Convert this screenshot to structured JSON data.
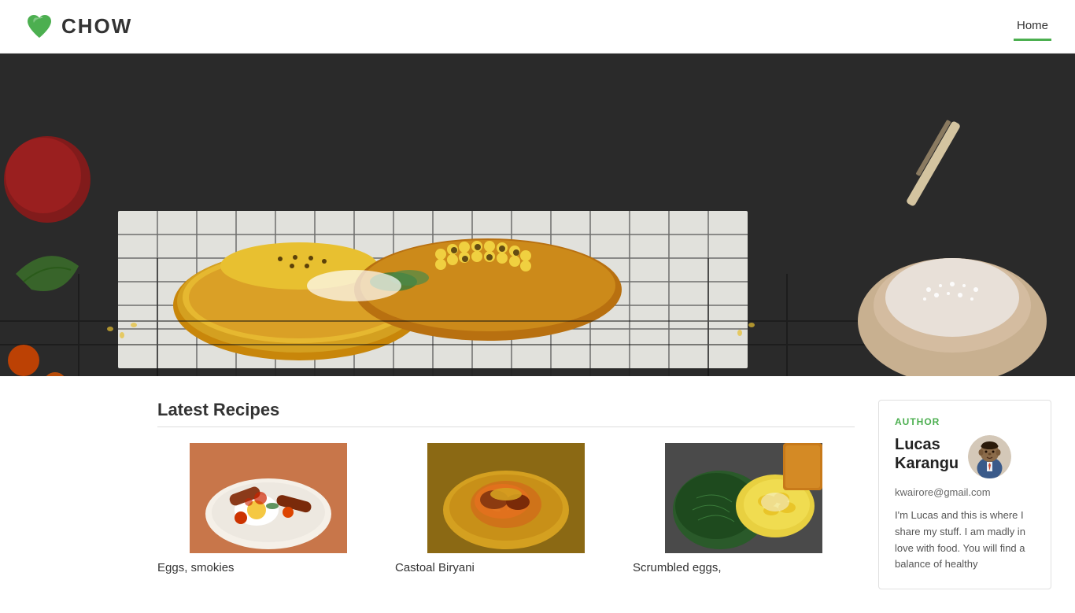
{
  "navbar": {
    "logo_text": "CHOW",
    "links": [
      {
        "label": "Home",
        "active": true
      }
    ]
  },
  "hero": {
    "alt": "Grilled corn on toast hero image"
  },
  "recipes_section": {
    "title": "Latest Recipes",
    "cards": [
      {
        "id": 1,
        "title": "Eggs, smokies",
        "image_color1": "#c8764a",
        "image_color2": "#8b3a1a",
        "image_label": "eggs-smokies"
      },
      {
        "id": 2,
        "title": "Castoal Biryani",
        "image_color1": "#d4a017",
        "image_color2": "#8b6914",
        "image_label": "biryani"
      },
      {
        "id": 3,
        "title": "Scrumbled eggs,",
        "image_color1": "#3a6b3a",
        "image_color2": "#d4d080",
        "image_label": "scrambled-eggs"
      }
    ]
  },
  "sidebar": {
    "author_card": {
      "author_label": "AUTHOR",
      "name_line1": "Lucas",
      "name_line2": "Karangu",
      "email": "kwairore@gmail.com",
      "bio": "I'm Lucas and this is where I share my stuff. I am madly in love with food. You will find a balance of healthy"
    }
  }
}
